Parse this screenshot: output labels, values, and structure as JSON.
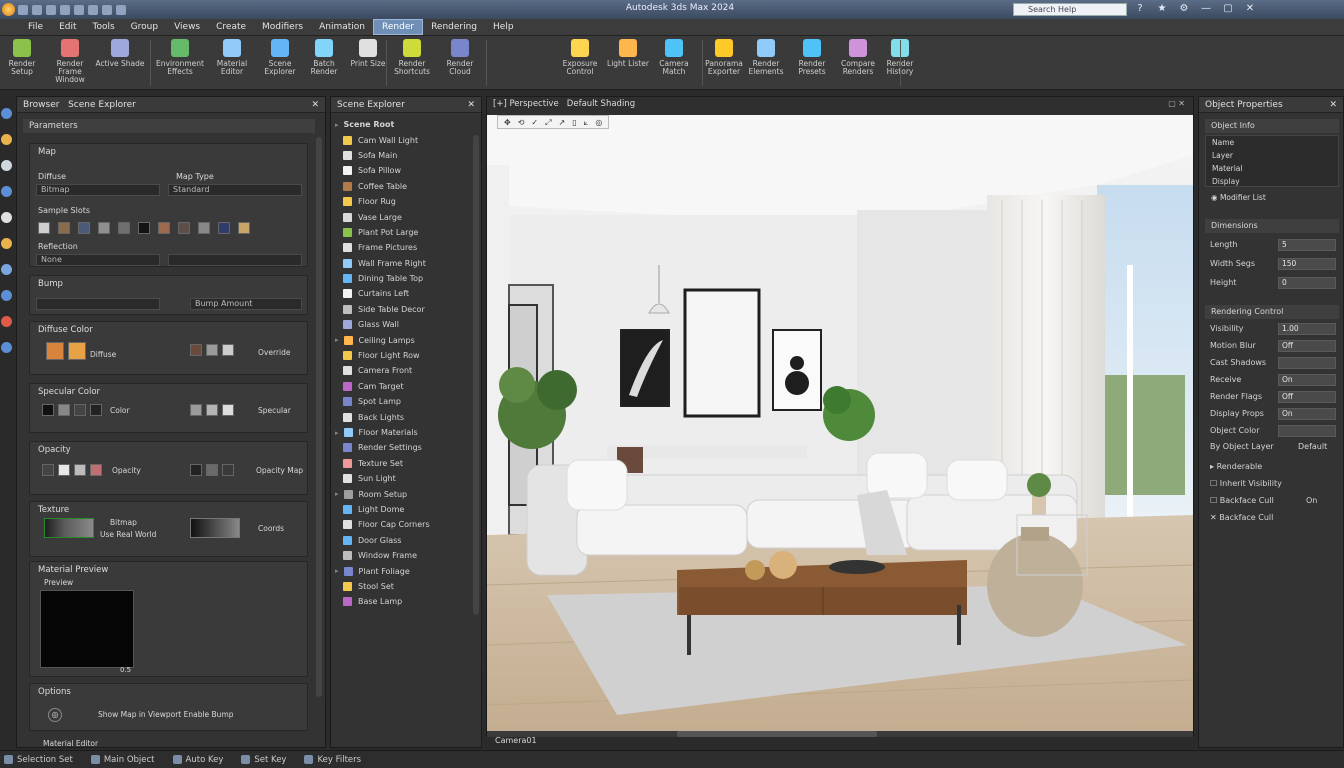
{
  "window": {
    "title": "Autodesk 3ds Max 2024",
    "search_placeholder": "Search Help",
    "controls": [
      "?",
      "★",
      "⚙",
      "—",
      "▢",
      "✕"
    ]
  },
  "menubar": {
    "items": [
      "File",
      "Edit",
      "Tools",
      "Group",
      "Views",
      "Create",
      "Modifiers",
      "Animation",
      "Render",
      "Rendering",
      "Help"
    ],
    "active_index": 8
  },
  "ribbon": {
    "buttons": [
      {
        "label": "Render Setup",
        "icon": "render-setup-icon",
        "color": "#8bc34a"
      },
      {
        "label": "Render Frame Window",
        "icon": "frame-window-icon",
        "color": "#e57373"
      },
      {
        "label": "Active Shade",
        "icon": "activeshade-icon",
        "color": "#9fa8da"
      },
      {
        "label": "Environment Effects",
        "icon": "environment-icon",
        "color": "#66bb6a"
      },
      {
        "label": "Material Editor",
        "icon": "material-editor-icon",
        "color": "#90caf9"
      },
      {
        "label": "Scene Explorer",
        "icon": "scene-explorer-icon",
        "color": "#64b5f6"
      },
      {
        "label": "Batch Render",
        "icon": "batch-render-icon",
        "color": "#81d4fa"
      },
      {
        "label": "Print Size",
        "icon": "print-size-icon",
        "color": "#e0e0e0"
      },
      {
        "label": "Render Shortcuts",
        "icon": "pencil-icon",
        "color": "#cddc39"
      },
      {
        "label": "Render Cloud",
        "icon": "cloud-icon",
        "color": "#7986cb"
      },
      {
        "label": "Exposure Control",
        "icon": "exposure-icon",
        "color": "#ffd54f"
      },
      {
        "label": "Light Lister",
        "icon": "brush-icon",
        "color": "#ffb74d"
      },
      {
        "label": "Camera Match",
        "icon": "camera-icon",
        "color": "#4fc3f7"
      },
      {
        "label": "Panorama Exporter",
        "icon": "star-icon",
        "color": "#ffca28"
      },
      {
        "label": "Render Elements",
        "icon": "elements-icon",
        "color": "#90caf9"
      },
      {
        "label": "Render Presets",
        "icon": "presets-icon",
        "color": "#4fc3f7"
      },
      {
        "label": "Compare Renders",
        "icon": "compare-icon",
        "color": "#ce93d8"
      },
      {
        "label": "Render History",
        "icon": "history-icon",
        "color": "#80deea"
      }
    ]
  },
  "material_panel": {
    "tabs": [
      "Browser",
      "Scene Explorer"
    ],
    "title": "Parameters",
    "map_section": "Map",
    "base_label": "Diffuse",
    "map_label": "Map Type",
    "base_value": "Bitmap",
    "map_value": "Standard",
    "swatch_title": "Sample Slots",
    "swatch_colors": [
      "#cfcfcf",
      "#8a6b4e",
      "#4a5a78",
      "#909090",
      "#6e6e6e",
      "#141414",
      "#9c6a4f",
      "#5c4f48",
      "#888888",
      "#2e3d6a",
      "#c9a36a"
    ],
    "reflect_label": "Reflection",
    "reflect_value": "None",
    "bump_label": "Bump",
    "bump_value": "Bump Amount",
    "diffuse_title": "Diffuse Color",
    "diffuse_colors": [
      "#d8843c",
      "#e6a244"
    ],
    "diffuse_text": "Diffuse",
    "diffuse_right": "Override",
    "diffuse_right_colors": [
      "#6a4a3a",
      "#9a9a9a",
      "#cccccc"
    ],
    "specular_title": "Specular Color",
    "specular_colors": [
      "#111111",
      "#888888",
      "#444444",
      "#222222"
    ],
    "specular_text": "Color",
    "specular_right": "Specular",
    "specular_right_colors": [
      "#9a9a9a",
      "#b4b4b4",
      "#dddddd"
    ],
    "opacity_title": "Opacity",
    "opacity_colors": [
      "#444444",
      "#e8e8e8",
      "#bbbbbb",
      "#c07070"
    ],
    "opacity_text": "Opacity",
    "opacity_right": "Opacity Map",
    "opacity_right_colors": [
      "#222222",
      "#6a6a6a",
      "#3a3a3a"
    ],
    "texture_title": "Texture",
    "texture_text": "Bitmap",
    "texture_text2": "Use Real World",
    "texture_right": "Coords",
    "preview_title": "Material Preview",
    "preview_label": "Preview",
    "preview_value": "0.5",
    "options_title": "Options",
    "options_text": "Show Map in Viewport Enable Bump",
    "footer": "Material Editor"
  },
  "scene_panel": {
    "title": "Scene Explorer",
    "root": "Scene Root",
    "items": [
      {
        "label": "Cam Wall Light",
        "color": "#f2c94c"
      },
      {
        "label": "Sofa Main",
        "color": "#e0e0e0"
      },
      {
        "label": "Sofa Pillow",
        "color": "#f2f2f2"
      },
      {
        "label": "Coffee Table",
        "color": "#b07a4a"
      },
      {
        "label": "Floor Rug",
        "color": "#f2c94c"
      },
      {
        "label": "Vase Large",
        "color": "#d9d9d9"
      },
      {
        "label": "Plant Pot Large",
        "color": "#8bc34a"
      },
      {
        "label": "Frame Pictures",
        "color": "#e0e0e0"
      },
      {
        "label": "Wall Frame Right",
        "color": "#90caf9"
      },
      {
        "label": "Dining Table Top",
        "color": "#64b5f6"
      },
      {
        "label": "Curtains Left",
        "color": "#f2f2f2"
      },
      {
        "label": "Side Table Decor",
        "color": "#bdbdbd"
      },
      {
        "label": "Glass Wall",
        "color": "#9fa8da"
      },
      {
        "label": "Ceiling Lamps",
        "color": "#ffb74d",
        "group": true
      },
      {
        "label": "Floor Light Row",
        "color": "#f2c94c"
      },
      {
        "label": "Camera Front",
        "color": "#e0e0e0"
      },
      {
        "label": "Cam Target",
        "color": "#ba68c8"
      },
      {
        "label": "Spot Lamp",
        "color": "#7986cb"
      },
      {
        "label": "Back Lights",
        "color": "#e0e0e0"
      },
      {
        "label": "Floor Materials",
        "color": "#90caf9",
        "group": true
      },
      {
        "label": "Render Settings",
        "color": "#7986cb"
      },
      {
        "label": "Texture Set",
        "color": "#ef9a9a"
      },
      {
        "label": "Sun Light",
        "color": "#e0e0e0"
      },
      {
        "label": "Room Setup",
        "color": "#9e9e9e",
        "group": true
      },
      {
        "label": "Light Dome",
        "color": "#64b5f6"
      },
      {
        "label": "Floor Cap Corners",
        "color": "#e0e0e0"
      },
      {
        "label": "Door Glass",
        "color": "#64b5f6"
      },
      {
        "label": "Window Frame",
        "color": "#bdbdbd"
      },
      {
        "label": "Plant Foliage",
        "color": "#7986cb",
        "group": true
      },
      {
        "label": "Stool Set",
        "color": "#f2c94c"
      },
      {
        "label": "Base Lamp",
        "color": "#ba68c8"
      }
    ]
  },
  "viewport": {
    "label": "[+] Perspective",
    "shading": "Default Shading",
    "tools": [
      "✥",
      "⟲",
      "✓",
      "⤢",
      "↗",
      "▯",
      "⟀",
      "◎"
    ],
    "footer": "Camera01"
  },
  "properties_panel": {
    "title": "Object Properties",
    "section1": "Object Info",
    "list": [
      "Name",
      "Layer",
      "Material",
      "Display"
    ],
    "mod_button": "Modifier List",
    "section2": "Dimensions",
    "rows1": [
      {
        "label": "Length",
        "value": "5"
      },
      {
        "label": "Width Segs",
        "value": "150"
      },
      {
        "label": "Height",
        "value": "0"
      }
    ],
    "section3": "Rendering Control",
    "rows2": [
      {
        "label": "Visibility",
        "value": "1.00"
      },
      {
        "label": "Motion Blur",
        "value": "Off"
      },
      {
        "label": "Cast Shadows",
        "value": ""
      },
      {
        "label": "Receive",
        "value": "On"
      },
      {
        "label": "Render Flags",
        "value": "Off"
      },
      {
        "label": "Display Props",
        "value": "On"
      },
      {
        "label": "Object Color",
        "value": ""
      }
    ],
    "flags_label": "By Object Layer",
    "flags_value": "Default",
    "opt1": "Renderable",
    "opt2": "Inherit Visibility",
    "opt3": "Backface Cull",
    "opt3_value": "On"
  },
  "statusbar": {
    "items": [
      "Selection Set",
      "Main Object",
      "Auto Key",
      "Set Key",
      "Key Filters"
    ]
  }
}
